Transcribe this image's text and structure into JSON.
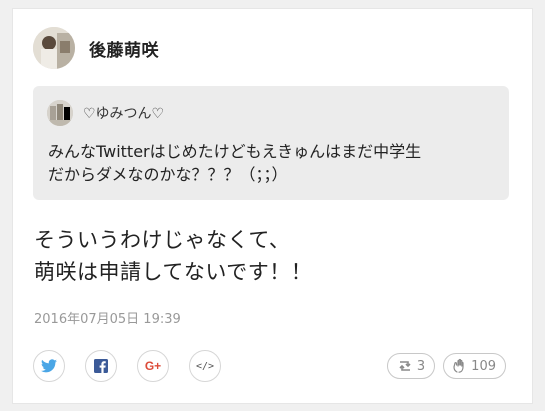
{
  "post": {
    "author": "後藤萌咲",
    "quoted": {
      "author": "♡ゆみつん♡",
      "text_line1": "みんなTwitterはじめたけどもえきゅんはまだ中学生",
      "text_line2": "だからダメなのかな？？？（；；）"
    },
    "text_line1": "そういうわけじゃなくて、",
    "text_line2": "萌咲は申請してないです！！",
    "date": "2016年07月05日 19:39"
  },
  "share": {
    "buttons": [
      "twitter-icon",
      "facebook-icon",
      "google-plus-icon",
      "embed-code-icon"
    ],
    "google_plus_label": "G+",
    "embed_label": "</>"
  },
  "stats": {
    "retweets": "3",
    "likes": "109"
  },
  "colors": {
    "twitter": "#4aa6e6",
    "facebook": "#3b5a98",
    "google_plus": "#dd4b39",
    "embed": "#555555",
    "quote_bg": "#ececec"
  }
}
